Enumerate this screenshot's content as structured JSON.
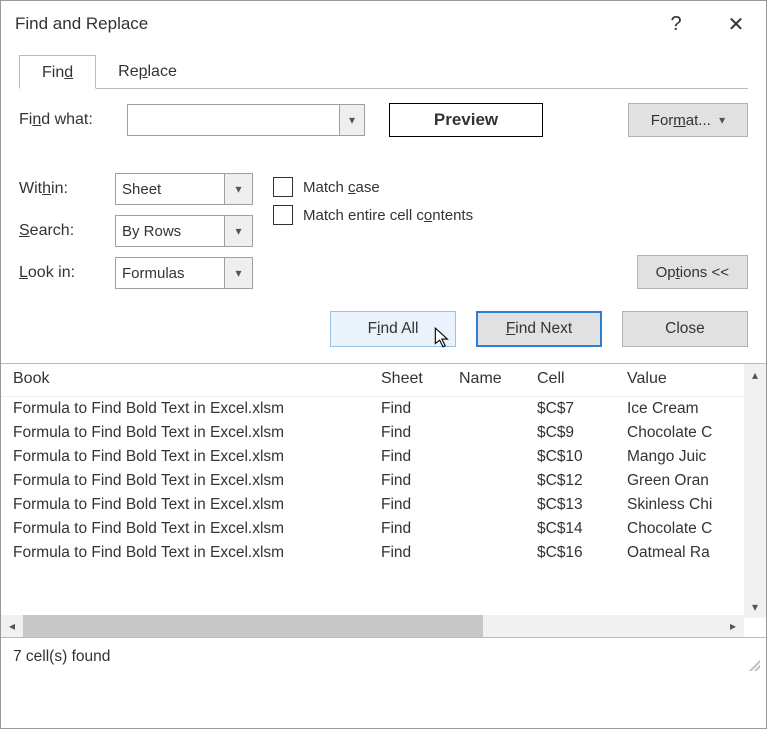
{
  "dialog": {
    "title": "Find and Replace",
    "help_glyph": "?",
    "close_glyph": "✕"
  },
  "tabs": {
    "find": "Find",
    "find_uchar": "d",
    "replace": "Replace",
    "replace_uchar": "p"
  },
  "labels": {
    "find_what": "Find what:",
    "find_what_uchar": "n",
    "within": "Within:",
    "within_uchar": "H",
    "search": "Search:",
    "search_uchar": "S",
    "look_in": "Look in:",
    "look_in_uchar": "L",
    "match_case": "Match case",
    "match_case_uchar": "c",
    "match_entire": "Match entire cell contents",
    "match_entire_uchar": "o"
  },
  "values": {
    "find_what": "",
    "within": "Sheet",
    "search": "By Rows",
    "look_in": "Formulas"
  },
  "buttons": {
    "preview": "Preview",
    "format": "Format...",
    "format_uchar": "M",
    "options": "Options <<",
    "options_uchar": "T",
    "find_all": "Find All",
    "find_all_uchar": "I",
    "find_next": "Find Next",
    "find_next_uchar": "F",
    "close": "Close"
  },
  "results_header": {
    "book": "Book",
    "sheet": "Sheet",
    "name": "Name",
    "cell": "Cell",
    "value": "Value"
  },
  "results": [
    {
      "book": "Formula to Find Bold Text in Excel.xlsm",
      "sheet": "Find",
      "name": "",
      "cell": "$C$7",
      "value": "Ice Cream"
    },
    {
      "book": "Formula to Find Bold Text in Excel.xlsm",
      "sheet": "Find",
      "name": "",
      "cell": "$C$9",
      "value": "Chocolate C"
    },
    {
      "book": "Formula to Find Bold Text in Excel.xlsm",
      "sheet": "Find",
      "name": "",
      "cell": "$C$10",
      "value": "Mango Juic"
    },
    {
      "book": "Formula to Find Bold Text in Excel.xlsm",
      "sheet": "Find",
      "name": "",
      "cell": "$C$12",
      "value": "Green Oran"
    },
    {
      "book": "Formula to Find Bold Text in Excel.xlsm",
      "sheet": "Find",
      "name": "",
      "cell": "$C$13",
      "value": "Skinless Chi"
    },
    {
      "book": "Formula to Find Bold Text in Excel.xlsm",
      "sheet": "Find",
      "name": "",
      "cell": "$C$14",
      "value": "Chocolate C"
    },
    {
      "book": "Formula to Find Bold Text in Excel.xlsm",
      "sheet": "Find",
      "name": "",
      "cell": "$C$16",
      "value": "Oatmeal Ra"
    }
  ],
  "status": "7 cell(s) found"
}
